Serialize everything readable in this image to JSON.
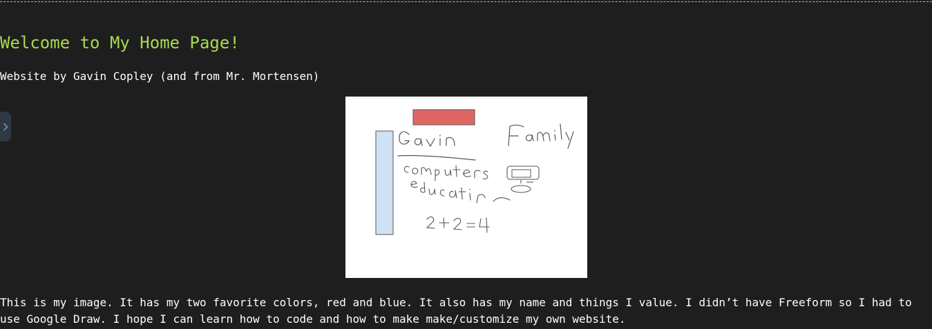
{
  "page": {
    "title": "Welcome to My Home Page!",
    "byline": "Website by Gavin Copley (and from Mr. Mortensen)",
    "description": "This is my image. It has my two favorite colors, red and blue. It also has my name and things I value. I didn’t have Freeform so I had to use Google Draw. I hope I can learn how to code and how to make make/customize my own website."
  },
  "drawing": {
    "colors": {
      "red_block": "#e06666",
      "blue_block": "#cfe2f3",
      "ink": "#555555"
    },
    "handwritten_labels": [
      "Gavin",
      "Family",
      "computers",
      "education",
      "2+2=4"
    ]
  },
  "theme": {
    "background": "#1e1e1e",
    "title_color": "#a8db50",
    "text_color": "#ffffff",
    "toggle_color": "#2d3944"
  },
  "icons": {
    "sidebar_toggle": "chevron-right-icon"
  }
}
